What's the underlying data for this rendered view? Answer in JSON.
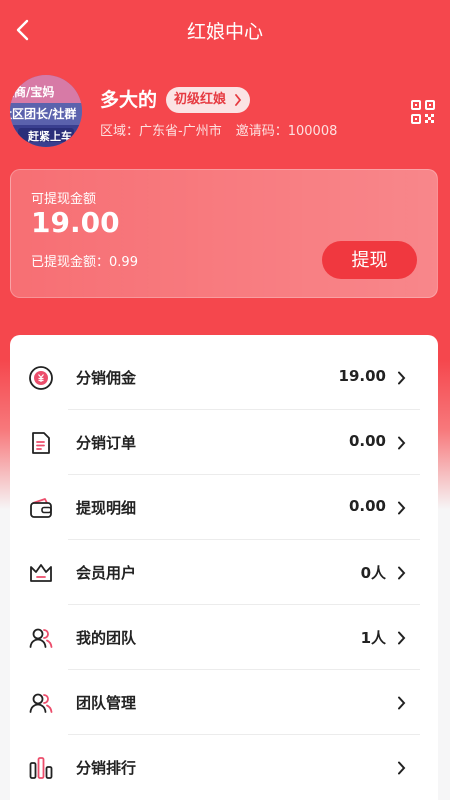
{
  "nav": {
    "title": "红娘中心"
  },
  "profile": {
    "avatar_lines": [
      "微商/宝妈",
      "社区团长/社群",
      "赶紧上车"
    ],
    "name": "多大的",
    "level": "初级红娘",
    "region_label": "区域：",
    "region": "广东省-广州市",
    "invite_label": "邀请码：",
    "invite_code": "100008"
  },
  "wallet": {
    "available_label": "可提现金额",
    "available_amount": "19.00",
    "withdrawn_label": "已提现金额：",
    "withdrawn_amount": "0.99",
    "withdraw_button": "提现"
  },
  "menu": [
    {
      "icon": "yen-coin-icon",
      "label": "分销佣金",
      "value": "19.00"
    },
    {
      "icon": "order-document-icon",
      "label": "分销订单",
      "value": "0.00"
    },
    {
      "icon": "wallet-icon",
      "label": "提现明细",
      "value": "0.00"
    },
    {
      "icon": "crown-icon",
      "label": "会员用户",
      "value": "0人"
    },
    {
      "icon": "team-icon",
      "label": "我的团队",
      "value": "1人"
    },
    {
      "icon": "team-manage-icon",
      "label": "团队管理",
      "value": ""
    },
    {
      "icon": "ranking-bars-icon",
      "label": "分销排行",
      "value": ""
    }
  ],
  "colors": {
    "primary": "#f5474d",
    "button": "#f0383f",
    "accent_pink": "#ec4d6b"
  }
}
